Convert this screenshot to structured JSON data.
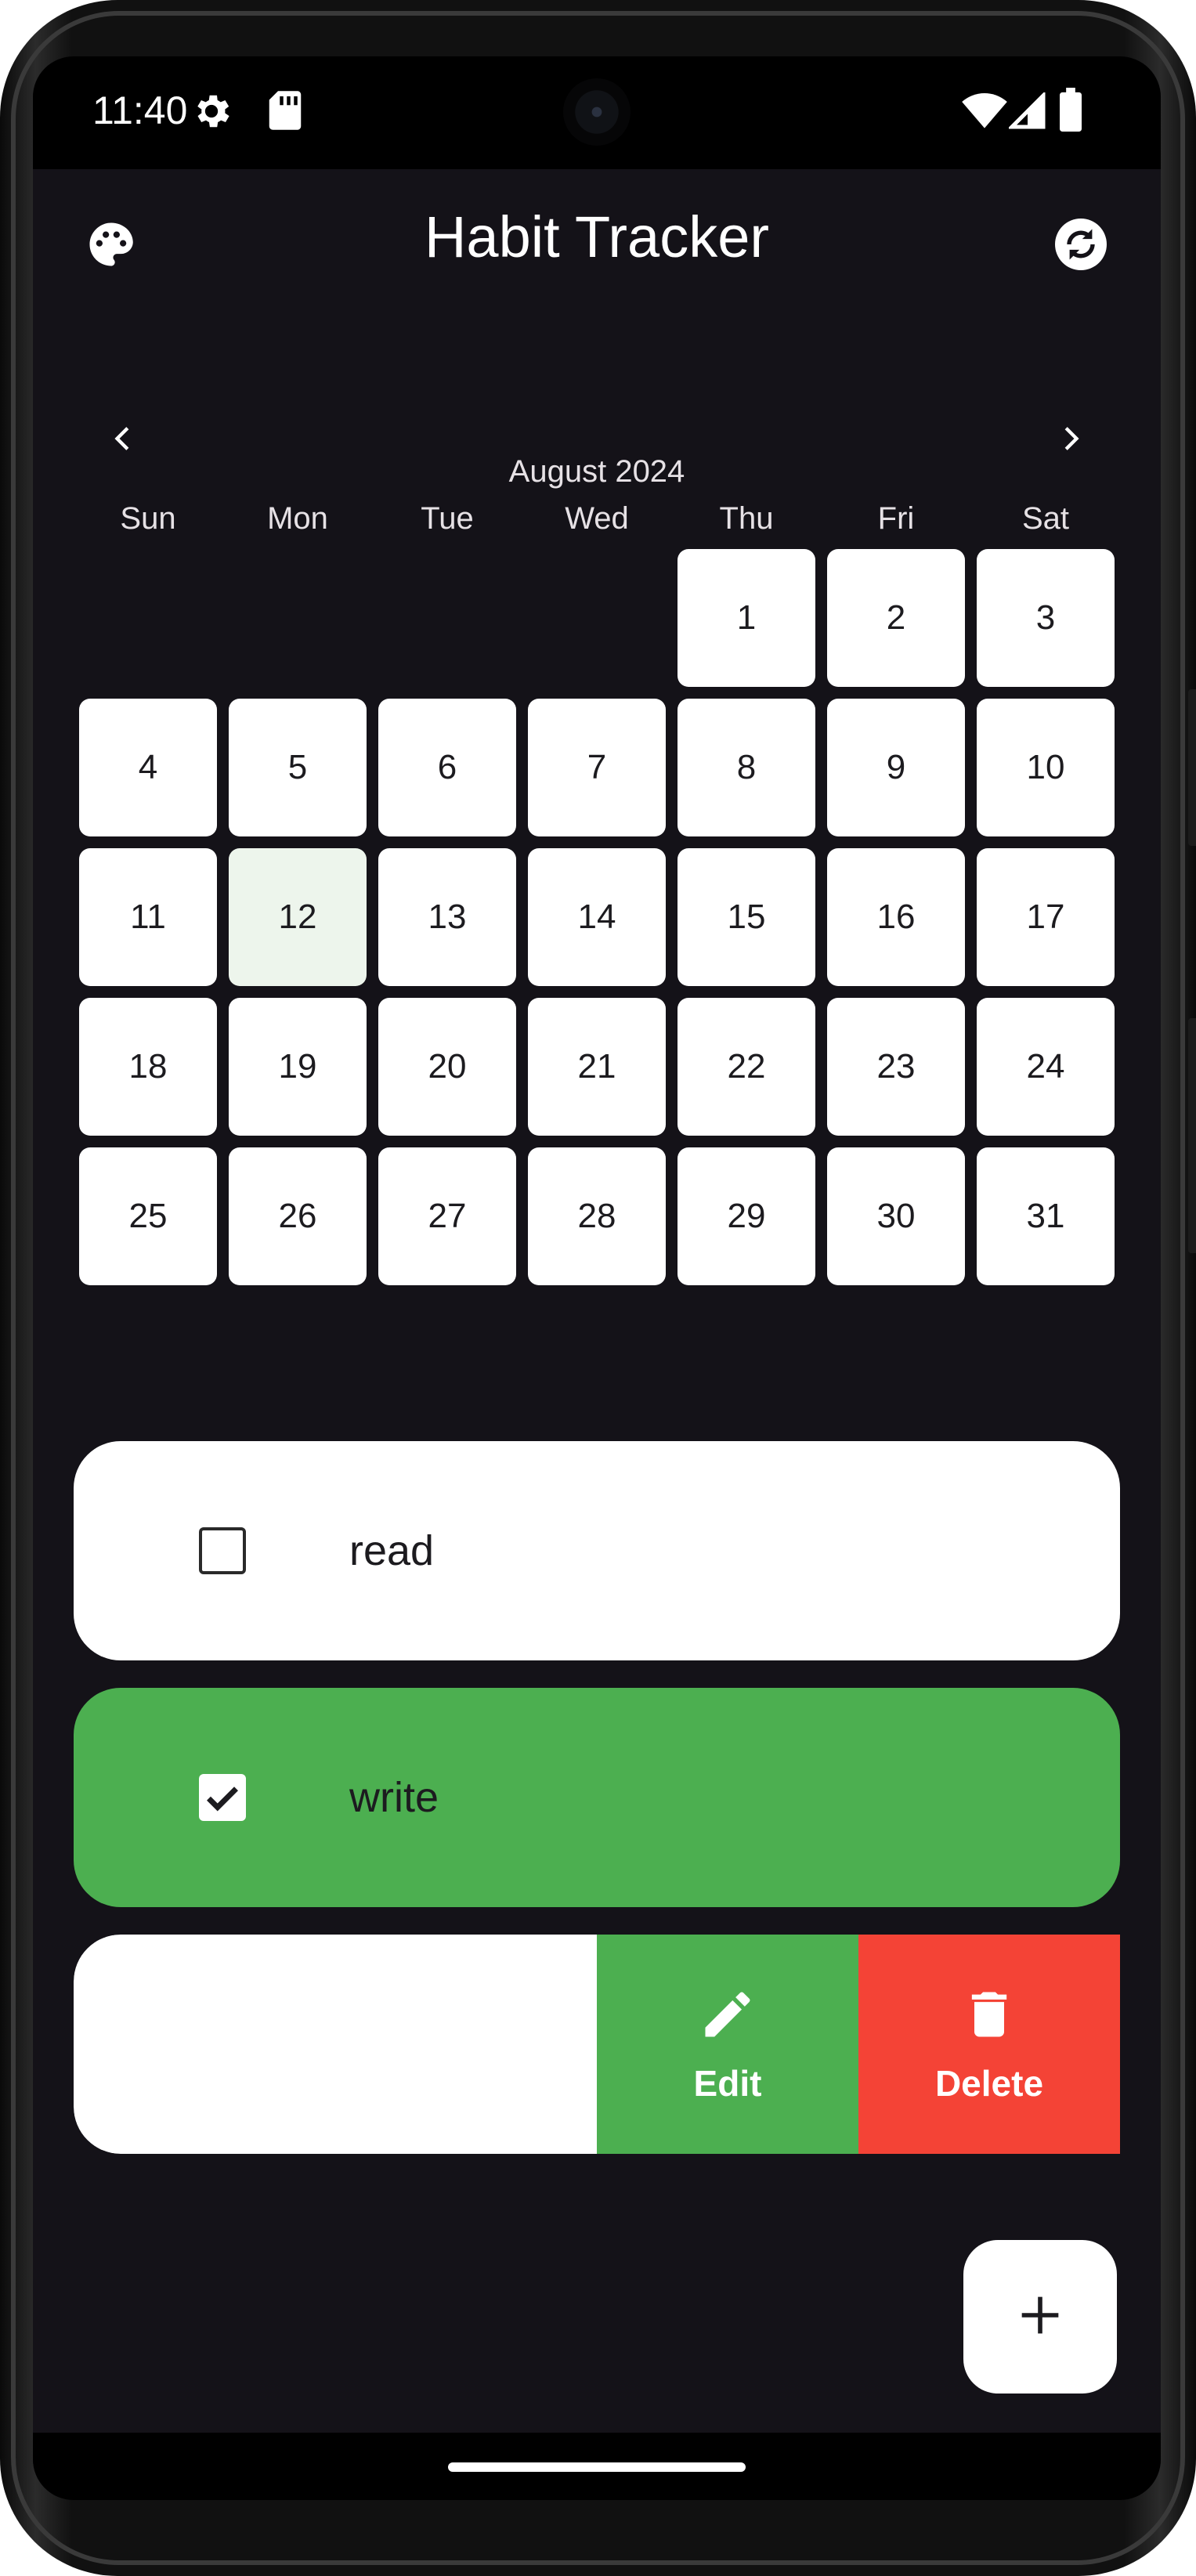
{
  "status_bar": {
    "time": "11:40",
    "icons": [
      "settings-gear-icon",
      "sd-card-icon",
      "wifi-icon",
      "cell-signal-icon",
      "battery-icon"
    ]
  },
  "app_bar": {
    "title": "Habit Tracker",
    "left_icon": "palette-icon",
    "right_icon": "sync-icon"
  },
  "calendar": {
    "month_label": "August 2024",
    "weekdays": [
      "Sun",
      "Mon",
      "Tue",
      "Wed",
      "Thu",
      "Fri",
      "Sat"
    ],
    "days": [
      "1",
      "2",
      "3",
      "4",
      "5",
      "6",
      "7",
      "8",
      "9",
      "10",
      "11",
      "12",
      "13",
      "14",
      "15",
      "16",
      "17",
      "18",
      "19",
      "20",
      "21",
      "22",
      "23",
      "24",
      "25",
      "26",
      "27",
      "28",
      "29",
      "30",
      "31"
    ],
    "first_weekday_index": 4,
    "highlighted_day": "12"
  },
  "habits": [
    {
      "name": "read",
      "completed": false,
      "color": "#ffffff"
    },
    {
      "name": "write",
      "completed": true,
      "color": "#4caf50"
    }
  ],
  "swipe_actions": {
    "edit_label": "Edit",
    "delete_label": "Delete",
    "edit_color": "#4caf50",
    "delete_color": "#f44336"
  },
  "fab": {
    "icon": "plus-icon"
  },
  "colors": {
    "background": "#141218",
    "accent_green": "#4caf50",
    "accent_red": "#f44336"
  }
}
